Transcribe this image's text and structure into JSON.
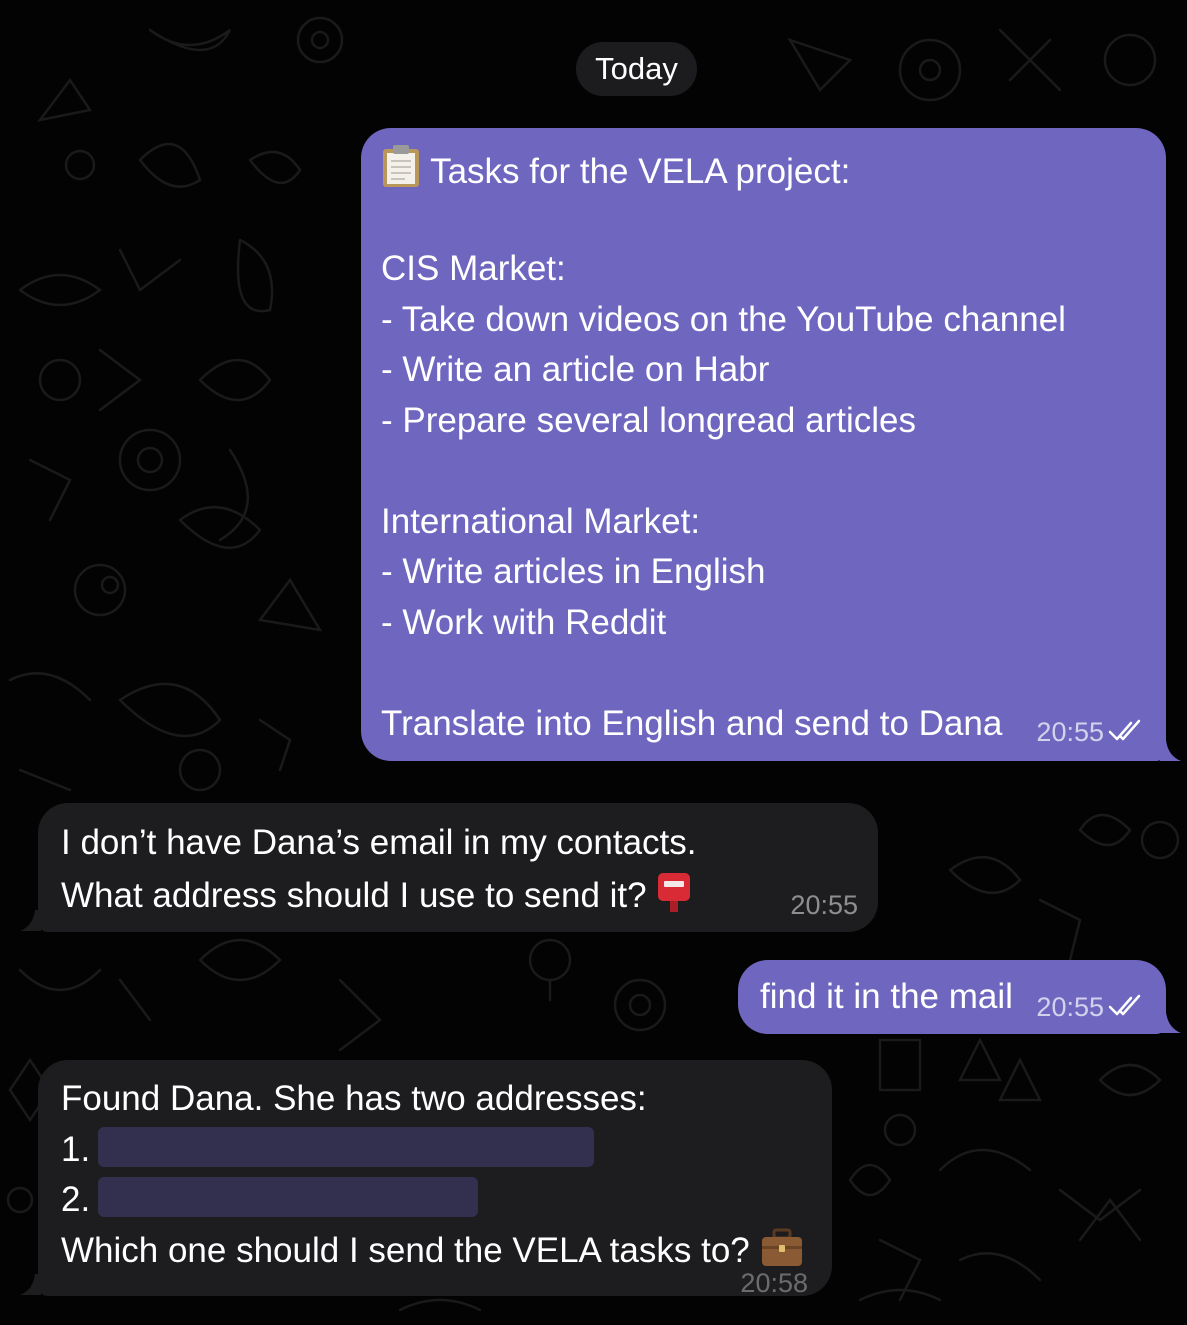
{
  "date_separator": "Today",
  "messages": [
    {
      "direction": "outgoing",
      "lines": [
        "Tasks for the VELA project:",
        "",
        "CIS Market:",
        "- Take down videos on the YouTube channel",
        "- Write an article on Habr",
        "- Prepare several longread articles",
        "",
        "International Market:",
        "- Write articles in English",
        "- Work with Reddit",
        "",
        "Translate into English and send to Dana"
      ],
      "leading_icon": "clipboard-icon",
      "time": "20:55",
      "status_icon": "double-check-icon"
    },
    {
      "direction": "incoming",
      "lines": [
        "I don’t have Dana’s email in my contacts.",
        "What address should I use to send it?"
      ],
      "trailing_icon": "postbox-icon",
      "time": "20:55"
    },
    {
      "direction": "outgoing",
      "lines": [
        "find it in the mail"
      ],
      "time": "20:55",
      "status_icon": "double-check-icon"
    },
    {
      "direction": "incoming",
      "lines": [
        "Found Dana. She has two addresses:",
        "1.",
        "2.",
        "Which one should I send the VELA tasks to?"
      ],
      "trailing_icon": "briefcase-icon",
      "time": "20:58"
    }
  ],
  "colors": {
    "outgoing_bubble": "#6f66c0",
    "incoming_bubble": "#1d1d1f",
    "background": "#030303",
    "redaction": "#33304f"
  }
}
